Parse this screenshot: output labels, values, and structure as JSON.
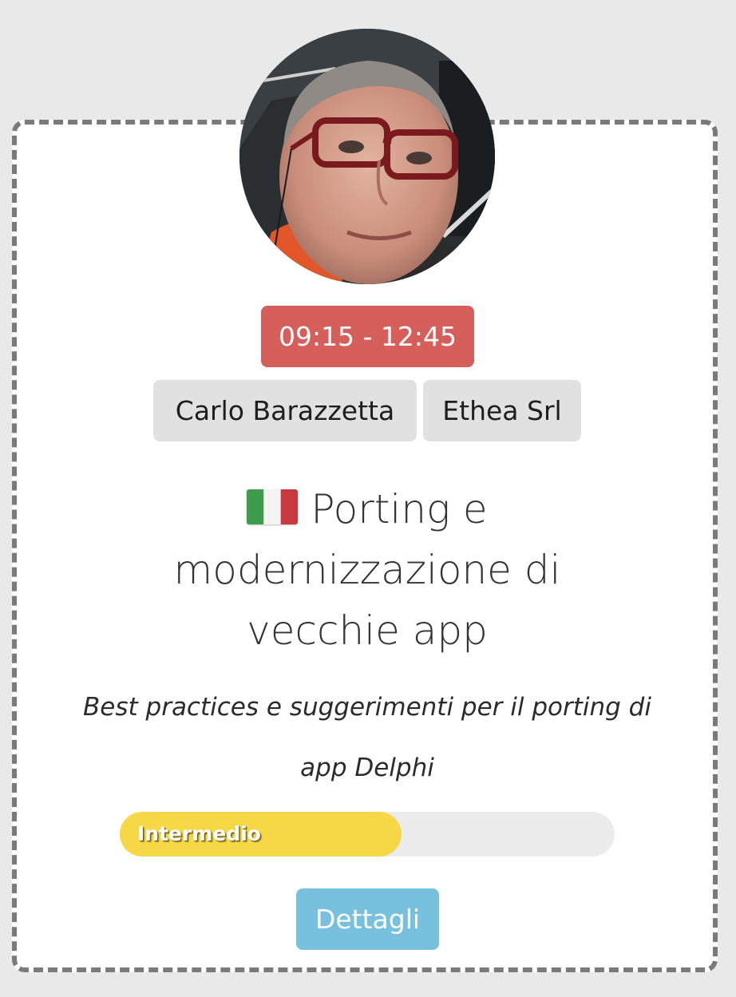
{
  "session": {
    "time": "09:15 - 12:45",
    "speaker": "Carlo Barazzetta",
    "company": "Ethea Srl",
    "language_flag": "italy-flag-icon",
    "title": "Porting e modernizzazione di vecchie app",
    "description": "Best practices e suggerimenti per il porting di app Delphi",
    "level": {
      "label": "Intermedio",
      "progress": 0.57,
      "color": "#f6d745"
    },
    "details_label": "Dettagli"
  },
  "colors": {
    "time_badge": "#d65f5b",
    "chip": "#e1e1e1",
    "details_button": "#77c0de",
    "card_border": "#7a7a7a",
    "background": "#e9e9e9"
  }
}
